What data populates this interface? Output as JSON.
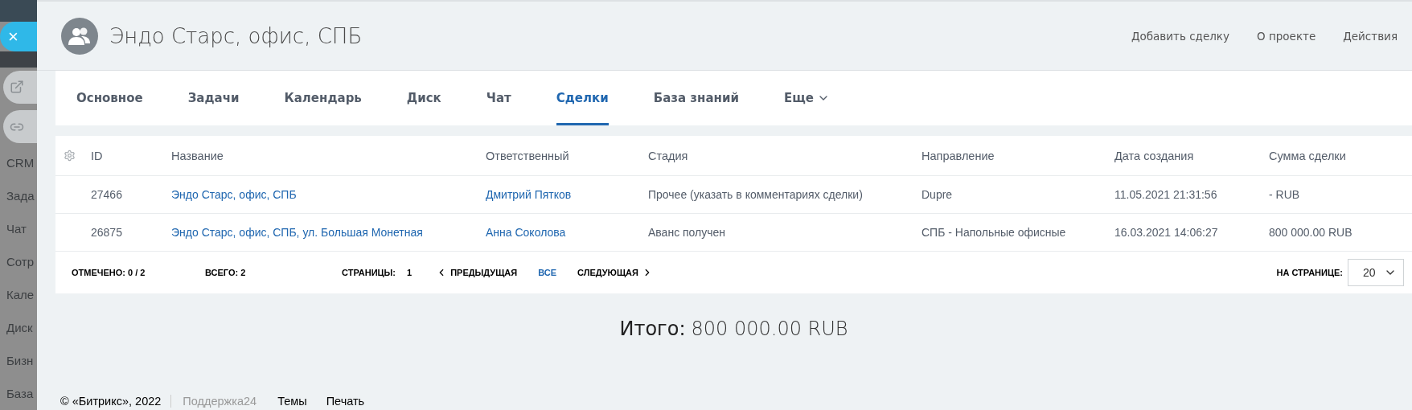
{
  "sidebar": {
    "close_label": "×",
    "items": [
      {
        "label": "CRM"
      },
      {
        "label": "Зада"
      },
      {
        "label": "Чат"
      },
      {
        "label": "Сотр"
      },
      {
        "label": "Кале"
      },
      {
        "label": "Диск"
      },
      {
        "label": "Бизн"
      },
      {
        "label": "База"
      }
    ]
  },
  "header": {
    "title": "Эндо Старс, офис, СПБ",
    "actions": [
      "Добавить сделку",
      "О проекте",
      "Действия"
    ]
  },
  "tabs": [
    {
      "label": "Основное",
      "selected": false,
      "has_menu": false
    },
    {
      "label": "Задачи",
      "selected": false,
      "has_menu": false
    },
    {
      "label": "Календарь",
      "selected": false,
      "has_menu": false
    },
    {
      "label": "Диск",
      "selected": false,
      "has_menu": false
    },
    {
      "label": "Чат",
      "selected": false,
      "has_menu": false
    },
    {
      "label": "Сделки",
      "selected": true,
      "has_menu": false
    },
    {
      "label": "База знаний",
      "selected": false,
      "has_menu": false
    },
    {
      "label": "Еще",
      "selected": false,
      "has_menu": true
    }
  ],
  "table": {
    "columns": [
      "ID",
      "Название",
      "Ответственный",
      "Стадия",
      "Направление",
      "Дата создания",
      "Сумма сделки"
    ],
    "rows": [
      {
        "cells": [
          "27466",
          "Эндо Старс, офис, СПБ",
          "Дмитрий Пятков",
          "Прочее (указать в комментариях сделки)",
          "Dupre",
          "11.05.2021 21:31:56",
          "- RUB"
        ]
      },
      {
        "cells": [
          "26875",
          "Эндо Старс, офис, СПБ, ул. Большая Монетная",
          "Анна Соколова",
          "Аванс получен",
          "СПБ - Напольные офисные",
          "16.03.2021 14:06:27",
          "800 000.00 RUB"
        ]
      }
    ],
    "footer": {
      "checked": "ОТМЕЧЕНО: 0 / 2",
      "total": "ВСЕГО: 2",
      "pages_label": "СТРАНИЦЫ:",
      "page": "1",
      "prev": "ПРЕДЫДУЩАЯ",
      "all": "ВСЕ",
      "next": "СЛЕДУЮЩАЯ",
      "per_page_label": "НА СТРАНИЦЕ:",
      "per_page": "20"
    }
  },
  "summary": {
    "label": "Итого:",
    "value": "800 000.00 RUB"
  },
  "page_footer": {
    "copyright": "© «Битрикс», 2022",
    "support": "Поддержка24",
    "links": [
      "Темы",
      "Печать"
    ]
  }
}
